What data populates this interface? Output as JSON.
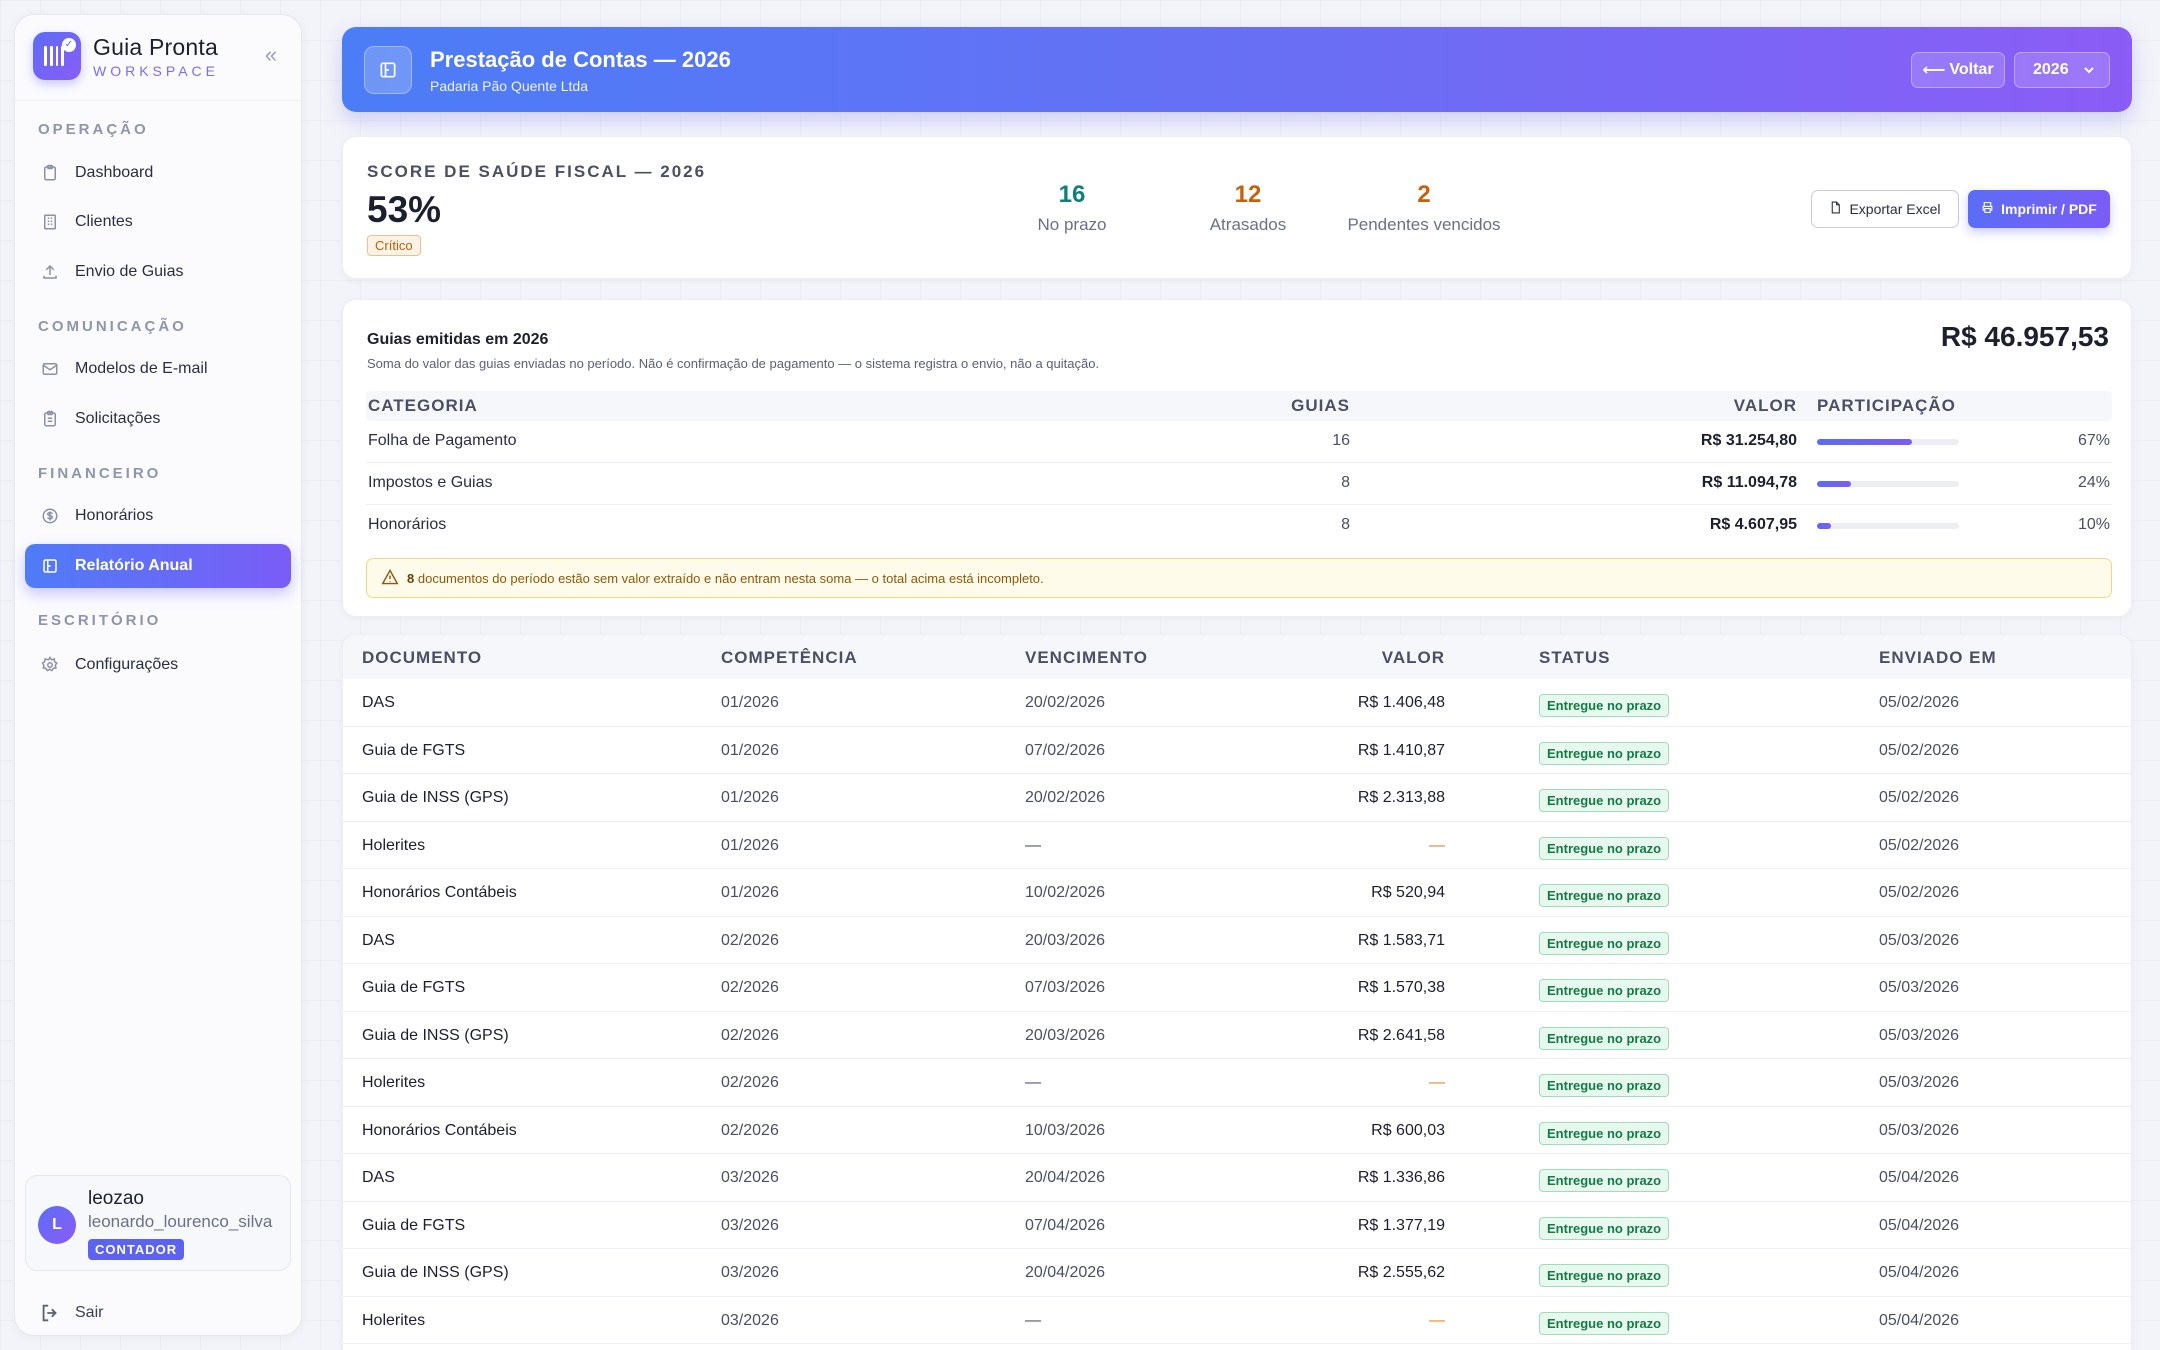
{
  "brand": {
    "name": "Guia Pronta",
    "sub": "WORKSPACE"
  },
  "sidebar": {
    "sections": [
      {
        "label": "OPERAÇÃO",
        "items": [
          {
            "label": "Dashboard",
            "icon": "clipboard-icon"
          },
          {
            "label": "Clientes",
            "icon": "building-icon"
          },
          {
            "label": "Envio de Guias",
            "icon": "upload-icon"
          }
        ]
      },
      {
        "label": "COMUNICAÇÃO",
        "items": [
          {
            "label": "Modelos de E-mail",
            "icon": "mail-icon"
          },
          {
            "label": "Solicitações",
            "icon": "clipboard-list-icon"
          }
        ]
      },
      {
        "label": "FINANCEIRO",
        "items": [
          {
            "label": "Honorários",
            "icon": "dollar-circle-icon"
          },
          {
            "label": "Relatório Anual",
            "icon": "report-icon"
          }
        ]
      },
      {
        "label": "ESCRITÓRIO",
        "items": [
          {
            "label": "Configurações",
            "icon": "gear-icon"
          }
        ]
      }
    ],
    "user": {
      "initial": "L",
      "name": "leozao",
      "email": "leonardo_lourenco_silva",
      "role": "CONTADOR"
    },
    "logout": "Sair"
  },
  "header": {
    "title": "Prestação de Contas — 2026",
    "subtitle": "Padaria Pão Quente Ltda",
    "back": "Voltar",
    "year": "2026"
  },
  "score": {
    "label": "SCORE DE SAÚDE FISCAL — 2026",
    "value": "53%",
    "badge": "Crítico",
    "stats": [
      {
        "num": "16",
        "label": "No prazo",
        "color": "#0f7f77"
      },
      {
        "num": "12",
        "label": "Atrasados",
        "color": "#c2620f"
      },
      {
        "num": "2",
        "label": "Pendentes vencidos",
        "color": "#c2620f"
      }
    ],
    "export_excel": "Exportar Excel",
    "print_pdf": "Imprimir / PDF"
  },
  "guias": {
    "title": "Guias emitidas em 2026",
    "description": "Soma do valor das guias enviadas no período. Não é confirmação de pagamento — o sistema registra o envio, não a quitação.",
    "total": "R$ 46.957,53",
    "columns": {
      "categoria": "CATEGORIA",
      "guias": "GUIAS",
      "valor": "VALOR",
      "participacao": "PARTICIPAÇÃO"
    },
    "rows": [
      {
        "categoria": "Folha de Pagamento",
        "guias": "16",
        "valor": "R$ 31.254,80",
        "share": 0.67,
        "pct": "67%"
      },
      {
        "categoria": "Impostos e Guias",
        "guias": "8",
        "valor": "R$ 11.094,78",
        "share": 0.24,
        "pct": "24%"
      },
      {
        "categoria": "Honorários",
        "guias": "8",
        "valor": "R$ 4.607,95",
        "share": 0.1,
        "pct": "10%"
      }
    ],
    "warning_count": "8",
    "warning_text": "documentos do período estão sem valor extraído e não entram nesta soma — o total acima está incompleto."
  },
  "table": {
    "columns": {
      "documento": "DOCUMENTO",
      "competencia": "COMPETÊNCIA",
      "vencimento": "VENCIMENTO",
      "valor": "VALOR",
      "status": "STATUS",
      "enviado": "ENVIADO EM"
    },
    "rows": [
      {
        "documento": "DAS",
        "competencia": "01/2026",
        "vencimento": "20/02/2026",
        "valor": "R$ 1.406,48",
        "status": "Entregue no prazo",
        "enviado": "05/02/2026"
      },
      {
        "documento": "Guia de FGTS",
        "competencia": "01/2026",
        "vencimento": "07/02/2026",
        "valor": "R$ 1.410,87",
        "status": "Entregue no prazo",
        "enviado": "05/02/2026"
      },
      {
        "documento": "Guia de INSS (GPS)",
        "competencia": "01/2026",
        "vencimento": "20/02/2026",
        "valor": "R$ 2.313,88",
        "status": "Entregue no prazo",
        "enviado": "05/02/2026"
      },
      {
        "documento": "Holerites",
        "competencia": "01/2026",
        "vencimento": "—",
        "valor": "—",
        "status": "Entregue no prazo",
        "enviado": "05/02/2026"
      },
      {
        "documento": "Honorários Contábeis",
        "competencia": "01/2026",
        "vencimento": "10/02/2026",
        "valor": "R$ 520,94",
        "status": "Entregue no prazo",
        "enviado": "05/02/2026"
      },
      {
        "documento": "DAS",
        "competencia": "02/2026",
        "vencimento": "20/03/2026",
        "valor": "R$ 1.583,71",
        "status": "Entregue no prazo",
        "enviado": "05/03/2026"
      },
      {
        "documento": "Guia de FGTS",
        "competencia": "02/2026",
        "vencimento": "07/03/2026",
        "valor": "R$ 1.570,38",
        "status": "Entregue no prazo",
        "enviado": "05/03/2026"
      },
      {
        "documento": "Guia de INSS (GPS)",
        "competencia": "02/2026",
        "vencimento": "20/03/2026",
        "valor": "R$ 2.641,58",
        "status": "Entregue no prazo",
        "enviado": "05/03/2026"
      },
      {
        "documento": "Holerites",
        "competencia": "02/2026",
        "vencimento": "—",
        "valor": "—",
        "status": "Entregue no prazo",
        "enviado": "05/03/2026"
      },
      {
        "documento": "Honorários Contábeis",
        "competencia": "02/2026",
        "vencimento": "10/03/2026",
        "valor": "R$ 600,03",
        "status": "Entregue no prazo",
        "enviado": "05/03/2026"
      },
      {
        "documento": "DAS",
        "competencia": "03/2026",
        "vencimento": "20/04/2026",
        "valor": "R$ 1.336,86",
        "status": "Entregue no prazo",
        "enviado": "05/04/2026"
      },
      {
        "documento": "Guia de FGTS",
        "competencia": "03/2026",
        "vencimento": "07/04/2026",
        "valor": "R$ 1.377,19",
        "status": "Entregue no prazo",
        "enviado": "05/04/2026"
      },
      {
        "documento": "Guia de INSS (GPS)",
        "competencia": "03/2026",
        "vencimento": "20/04/2026",
        "valor": "R$ 2.555,62",
        "status": "Entregue no prazo",
        "enviado": "05/04/2026"
      },
      {
        "documento": "Holerites",
        "competencia": "03/2026",
        "vencimento": "—",
        "valor": "—",
        "status": "Entregue no prazo",
        "enviado": "05/04/2026"
      }
    ]
  },
  "colors": {
    "accent": "#6366f1",
    "critical": "#b85f10",
    "success": "#157a45"
  }
}
